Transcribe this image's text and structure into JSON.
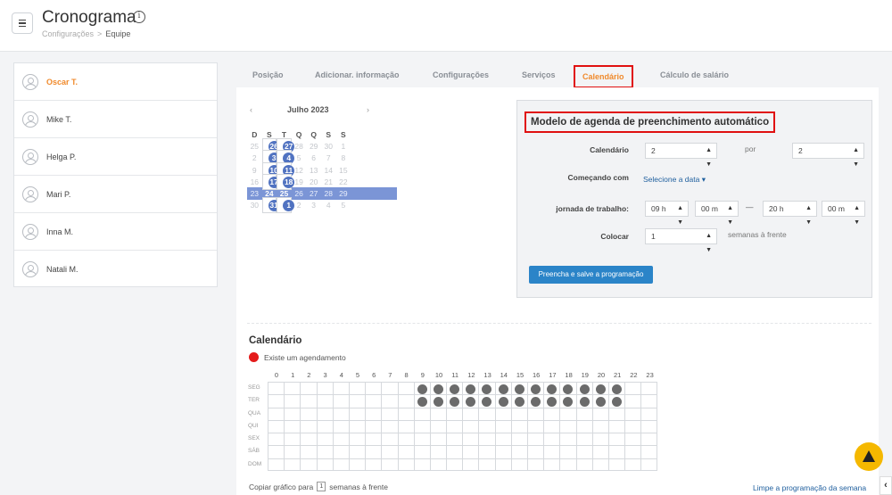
{
  "header": {
    "title": "Cronograma",
    "info_icon": "info-icon",
    "breadcrumb": {
      "parent": "Configurações",
      "separator": ">",
      "current": "Equipe"
    }
  },
  "sidebar": {
    "users": [
      {
        "name": "Oscar T.",
        "active": true
      },
      {
        "name": "Mike T.",
        "active": false
      },
      {
        "name": "Helga P.",
        "active": false
      },
      {
        "name": "Mari P.",
        "active": false
      },
      {
        "name": "Inna M.",
        "active": false
      },
      {
        "name": "Natali M.",
        "active": false
      }
    ]
  },
  "tabs": [
    {
      "label": "Posição"
    },
    {
      "label": "Adicionar. informação"
    },
    {
      "label": "Configurações"
    },
    {
      "label": "Serviços"
    },
    {
      "label": "Calendário",
      "active": true
    },
    {
      "label": "Cálculo de salário"
    }
  ],
  "mini_calendar": {
    "prev": "‹",
    "next": "›",
    "month": "Julho 2023",
    "weekdays": [
      "D",
      "S",
      "T",
      "Q",
      "Q",
      "S",
      "S"
    ],
    "weeks": [
      [
        "25",
        "26",
        "27",
        "28",
        "29",
        "30",
        "1"
      ],
      [
        "2",
        "3",
        "4",
        "5",
        "6",
        "7",
        "8"
      ],
      [
        "9",
        "10",
        "11",
        "12",
        "13",
        "14",
        "15"
      ],
      [
        "16",
        "17",
        "18",
        "19",
        "20",
        "21",
        "22"
      ],
      [
        "23",
        "24",
        "25",
        "26",
        "27",
        "28",
        "29"
      ],
      [
        "30",
        "31",
        "1",
        "2",
        "3",
        "4",
        "5"
      ]
    ],
    "today": "25"
  },
  "autofill": {
    "title": "Modelo de agenda de preenchimento automático",
    "calendar_label": "Calendário",
    "calendar_value": "2",
    "por_label": "por",
    "por_value": "2",
    "start_label": "Começando com",
    "start_link": "Selecione a data ▾",
    "workday_label": "jornada de trabalho:",
    "start_hour": "09 h",
    "start_min": "00 m",
    "dash": "—",
    "end_hour": "20 h",
    "end_min": "00 m",
    "place_label": "Colocar",
    "place_value": "1",
    "weeks_ahead": "semanas à frente",
    "fill_button": "Preencha e salve a programação"
  },
  "schedule": {
    "title": "Calendário",
    "legend": "Existe um agendamento",
    "legend_color": "#e41b1b",
    "hours": [
      "0",
      "1",
      "2",
      "3",
      "4",
      "5",
      "6",
      "7",
      "8",
      "9",
      "10",
      "11",
      "12",
      "13",
      "14",
      "15",
      "16",
      "17",
      "18",
      "19",
      "20",
      "21",
      "22",
      "23"
    ],
    "rows": [
      {
        "day": "SEG",
        "booked": [
          9,
          10,
          11,
          12,
          13,
          14,
          15,
          16,
          17,
          18,
          19,
          20,
          21
        ]
      },
      {
        "day": "TER",
        "booked": [
          9,
          10,
          11,
          12,
          13,
          14,
          15,
          16,
          17,
          18,
          19,
          20,
          21
        ]
      },
      {
        "day": "QUA",
        "booked": []
      },
      {
        "day": "QUI",
        "booked": []
      },
      {
        "day": "SEX",
        "booked": []
      },
      {
        "day": "SÁB",
        "booked": []
      },
      {
        "day": "DOM",
        "booked": []
      }
    ],
    "copy_prefix": "Copiar gráfico para",
    "copy_value": "1",
    "copy_suffix": "semanas à frente",
    "clear_link": "Limpe a programação da semana"
  },
  "colors": {
    "accent": "#f08a2c",
    "highlight": "#e01010",
    "primary": "#2b84c8",
    "calendar_select": "#5173c1"
  },
  "widgets": {
    "fab_icon": "assistant-icon",
    "collapse_icon": "‹"
  }
}
